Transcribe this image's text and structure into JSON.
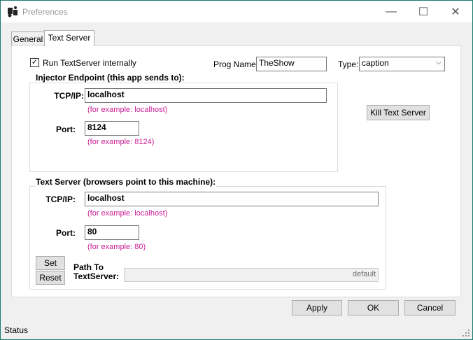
{
  "window": {
    "title": "Preferences"
  },
  "title_buttons": {
    "minimize": "—",
    "maximize": "☐",
    "close": "✕"
  },
  "tabs": [
    {
      "label": "General"
    },
    {
      "label": "Text Server"
    }
  ],
  "run_internally": {
    "label": "Run TextServer internally",
    "checked": true,
    "check_glyph": "✓"
  },
  "prog_name": {
    "label": "Prog Name:",
    "value": "TheShow"
  },
  "type": {
    "label": "Type:",
    "value": "caption",
    "arrow": "⌵"
  },
  "kill_button": "Kill Text Server",
  "injector": {
    "title": "Injector Endpoint (this app sends to):",
    "tcp_label": "TCP/IP:",
    "tcp_value": "localhost",
    "tcp_example": "(for example: localhost)",
    "port_label": "Port:",
    "port_value": "8124",
    "port_example": "(for example: 8124)"
  },
  "text_server": {
    "title": "Text Server (browsers point to this machine):",
    "tcp_label": "TCP/IP:",
    "tcp_value": "localhost",
    "tcp_example": "(for example: localhost)",
    "port_label": "Port:",
    "port_value": "80",
    "port_example": "(for example: 80)",
    "set_label": "Set",
    "reset_label": "Reset",
    "path_label_1": "Path To",
    "path_label_2": "TextServer:",
    "path_value": "default"
  },
  "buttons": {
    "apply": "Apply",
    "ok": "OK",
    "cancel": "Cancel"
  },
  "status": "Status",
  "colors": {
    "example_text": "#cc1f97",
    "window_border": "#1e7a6d"
  }
}
